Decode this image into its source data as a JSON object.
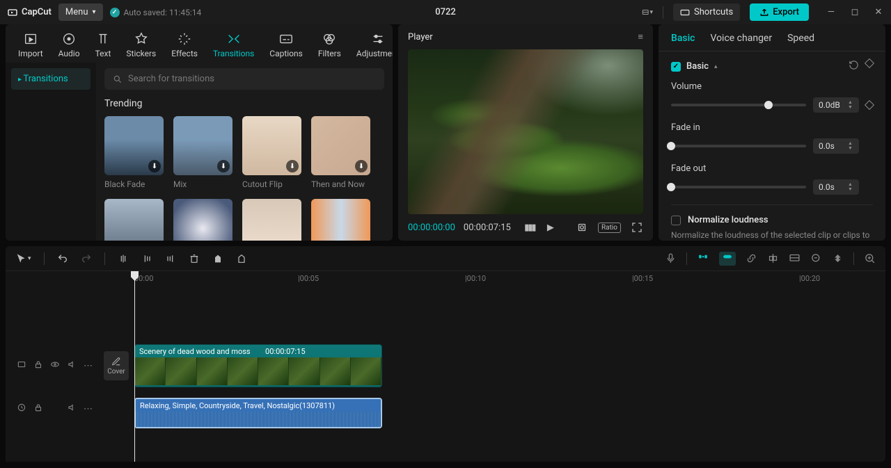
{
  "titlebar": {
    "app_name": "CapCut",
    "menu_label": "Menu",
    "autosave_text": "Auto saved: 11:45:14",
    "project_title": "0722",
    "shortcuts_label": "Shortcuts",
    "export_label": "Export"
  },
  "top_tabs": {
    "import": "Import",
    "audio": "Audio",
    "text": "Text",
    "stickers": "Stickers",
    "effects": "Effects",
    "transitions": "Transitions",
    "captions": "Captions",
    "filters": "Filters",
    "adjustment": "Adjustment"
  },
  "sidebar": {
    "transitions": "Transitions"
  },
  "transitions_panel": {
    "search_placeholder": "Search for transitions",
    "section": "Trending",
    "items": [
      {
        "label": "Black Fade"
      },
      {
        "label": "Mix"
      },
      {
        "label": "Cutout Flip"
      },
      {
        "label": "Then and Now"
      },
      {
        "label": ""
      },
      {
        "label": ""
      },
      {
        "label": ""
      },
      {
        "label": ""
      }
    ]
  },
  "player": {
    "title": "Player",
    "current_time": "00:00:00:00",
    "total_time": "00:00:07:15"
  },
  "inspector": {
    "tabs": {
      "basic": "Basic",
      "voice": "Voice changer",
      "speed": "Speed"
    },
    "basic_section": "Basic",
    "volume_label": "Volume",
    "volume_value": "0.0dB",
    "fadein_label": "Fade in",
    "fadein_value": "0.0s",
    "fadeout_label": "Fade out",
    "fadeout_value": "0.0s",
    "normalize_label": "Normalize loudness",
    "normalize_desc": "Normalize the loudness of the selected clip or clips to a"
  },
  "timeline": {
    "ticks": [
      "00:00",
      "|00:05",
      "|00:10",
      "|00:15",
      "|00:20"
    ],
    "cover_label": "Cover",
    "video_clip": {
      "name": "Scenery of dead wood and moss",
      "duration": "00:00:07:15"
    },
    "audio_clip": {
      "name": "Relaxing, Simple, Countryside, Travel, Nostalgic(1307811)"
    }
  }
}
